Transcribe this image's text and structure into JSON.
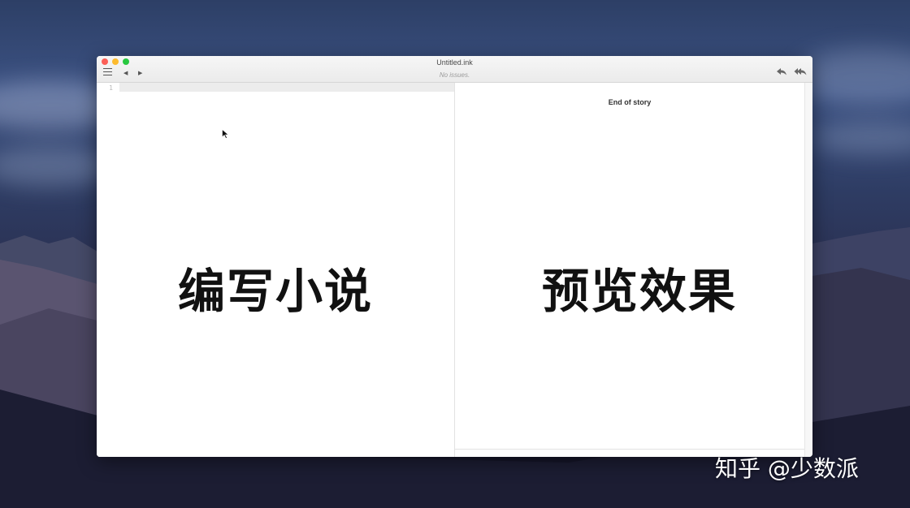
{
  "window": {
    "title": "Untitled.ink",
    "status": "No issues."
  },
  "toolbar": {
    "menu_icon": "hamburger-menu-icon",
    "back_glyph": "◀",
    "forward_glyph": "▶",
    "reply_glyph": "↩",
    "reply_all_glyph": "⇇"
  },
  "editor": {
    "line_numbers": [
      "1"
    ],
    "overlay_text": "编写小说"
  },
  "preview": {
    "end_text": "End of story",
    "overlay_text": "预览效果"
  },
  "watermark": "知乎 @少数派",
  "colors": {
    "close": "#fc5f57",
    "minimize": "#fdbb2e",
    "zoom": "#28c840"
  }
}
